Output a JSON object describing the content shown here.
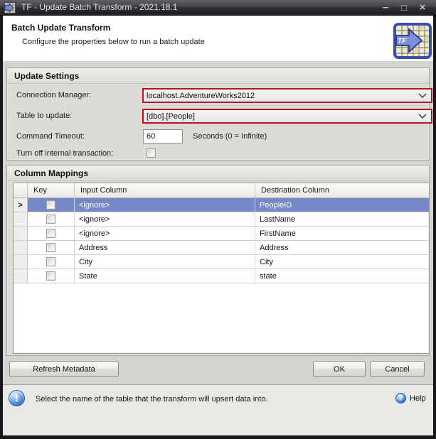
{
  "window": {
    "title": "TF - Update Batch Transform - 2021.18.1",
    "controls": {
      "minimize": "–",
      "maximize": "□",
      "close": "×"
    }
  },
  "header": {
    "title": "Batch Update Transform",
    "subtitle": "Configure the properties below to run a batch update",
    "icon_text": "TF"
  },
  "update_settings": {
    "title": "Update Settings",
    "connection_manager": {
      "label": "Connection Manager:",
      "value": "localhost.AdventureWorks2012"
    },
    "table_to_update": {
      "label": "Table to update:",
      "value": "[dbo].[People]"
    },
    "command_timeout": {
      "label": "Command Timeout:",
      "value": "60",
      "suffix": "Seconds (0 = Infinite)"
    },
    "internal_transaction": {
      "label": "Turn off internal transaction:",
      "checked": false
    }
  },
  "column_mappings": {
    "title": "Column Mappings",
    "columns": [
      "Key",
      "Input Column",
      "Destination Column"
    ],
    "rows": [
      {
        "key": false,
        "input": "<ignore>",
        "destination": "PeopleID",
        "selected": true
      },
      {
        "key": false,
        "input": "<ignore>",
        "destination": "LastName",
        "selected": false
      },
      {
        "key": false,
        "input": "<ignore>",
        "destination": "FirstName",
        "selected": false
      },
      {
        "key": false,
        "input": "Address",
        "destination": "Address",
        "selected": false
      },
      {
        "key": false,
        "input": "City",
        "destination": "City",
        "selected": false
      },
      {
        "key": false,
        "input": "State",
        "destination": "state",
        "selected": false
      }
    ]
  },
  "buttons": {
    "refresh_label": "Refresh Metadata",
    "ok_label": "OK",
    "cancel_label": "Cancel"
  },
  "status_bar": {
    "message": "Select the name of the table that the transform will upsert data into.",
    "help_label": "Help"
  },
  "icons": {
    "info_glyph": "!",
    "help_glyph": "?",
    "current_row_arrow": ">"
  },
  "colors": {
    "accent_red": "#b0121f",
    "selection_blue": "#7589c8",
    "titlebar_dark": "#2c2c31",
    "content_gray": "#d5d4d0"
  }
}
